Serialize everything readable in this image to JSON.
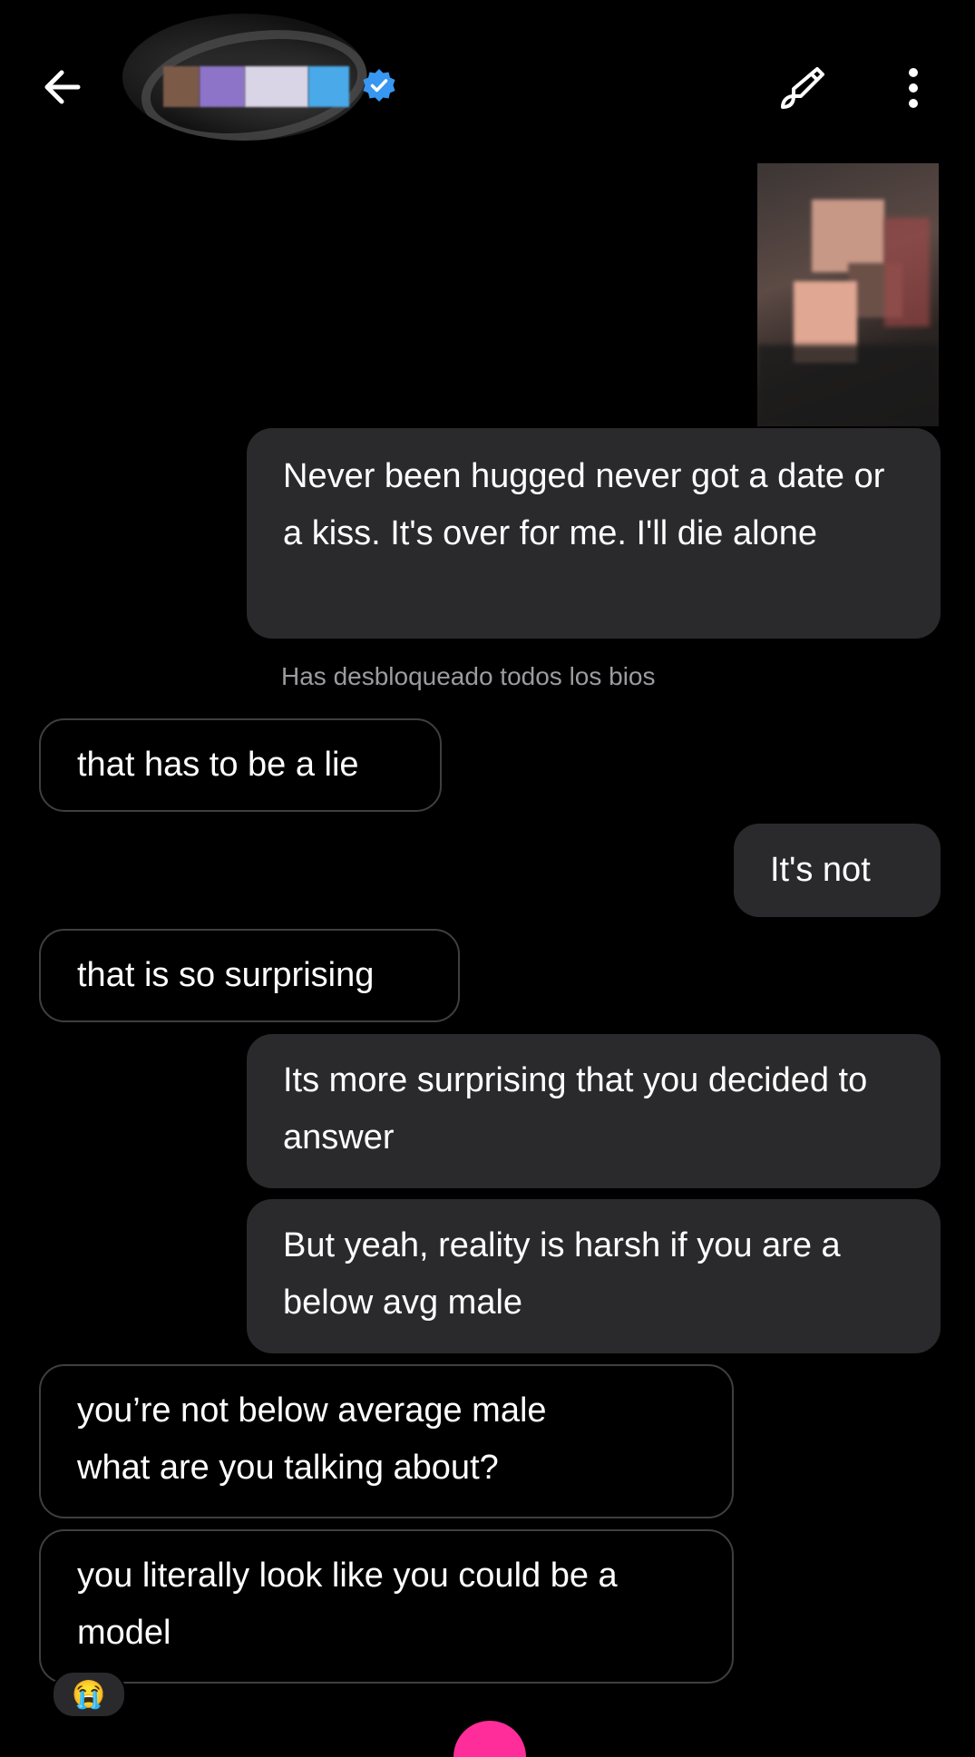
{
  "header": {
    "back_icon": "arrow-left-icon",
    "verified_icon": "verified-badge-icon",
    "verified_color": "#3897f0",
    "brush_icon": "paint-brush-icon",
    "more_icon": "more-vertical-icon"
  },
  "messages": [
    {
      "direction": "out",
      "text": "Never been hugged never got a date or a kiss. It's over for me. I'll die alone"
    },
    {
      "direction": "in",
      "text": "that has to be a lie"
    },
    {
      "direction": "out",
      "text": "It's not"
    },
    {
      "direction": "in",
      "text": "that is so surprising"
    },
    {
      "direction": "out",
      "text": "Its more surprising that you decided to answer"
    },
    {
      "direction": "out",
      "text": "But yeah, reality is harsh if you are a below avg male"
    },
    {
      "direction": "in",
      "text": "you’re not below average male what are you talking about?"
    },
    {
      "direction": "in",
      "text": "you literally look like you could be a model"
    }
  ],
  "system_note": "Has desbloqueado todos los bios",
  "reaction": {
    "emoji": "😭"
  },
  "colors": {
    "background": "#000000",
    "outgoing_bubble": "#2a2a2c",
    "incoming_border": "#3f3f42",
    "system_text": "#9b9ba0",
    "accent_pink": "#ff2d9a"
  }
}
